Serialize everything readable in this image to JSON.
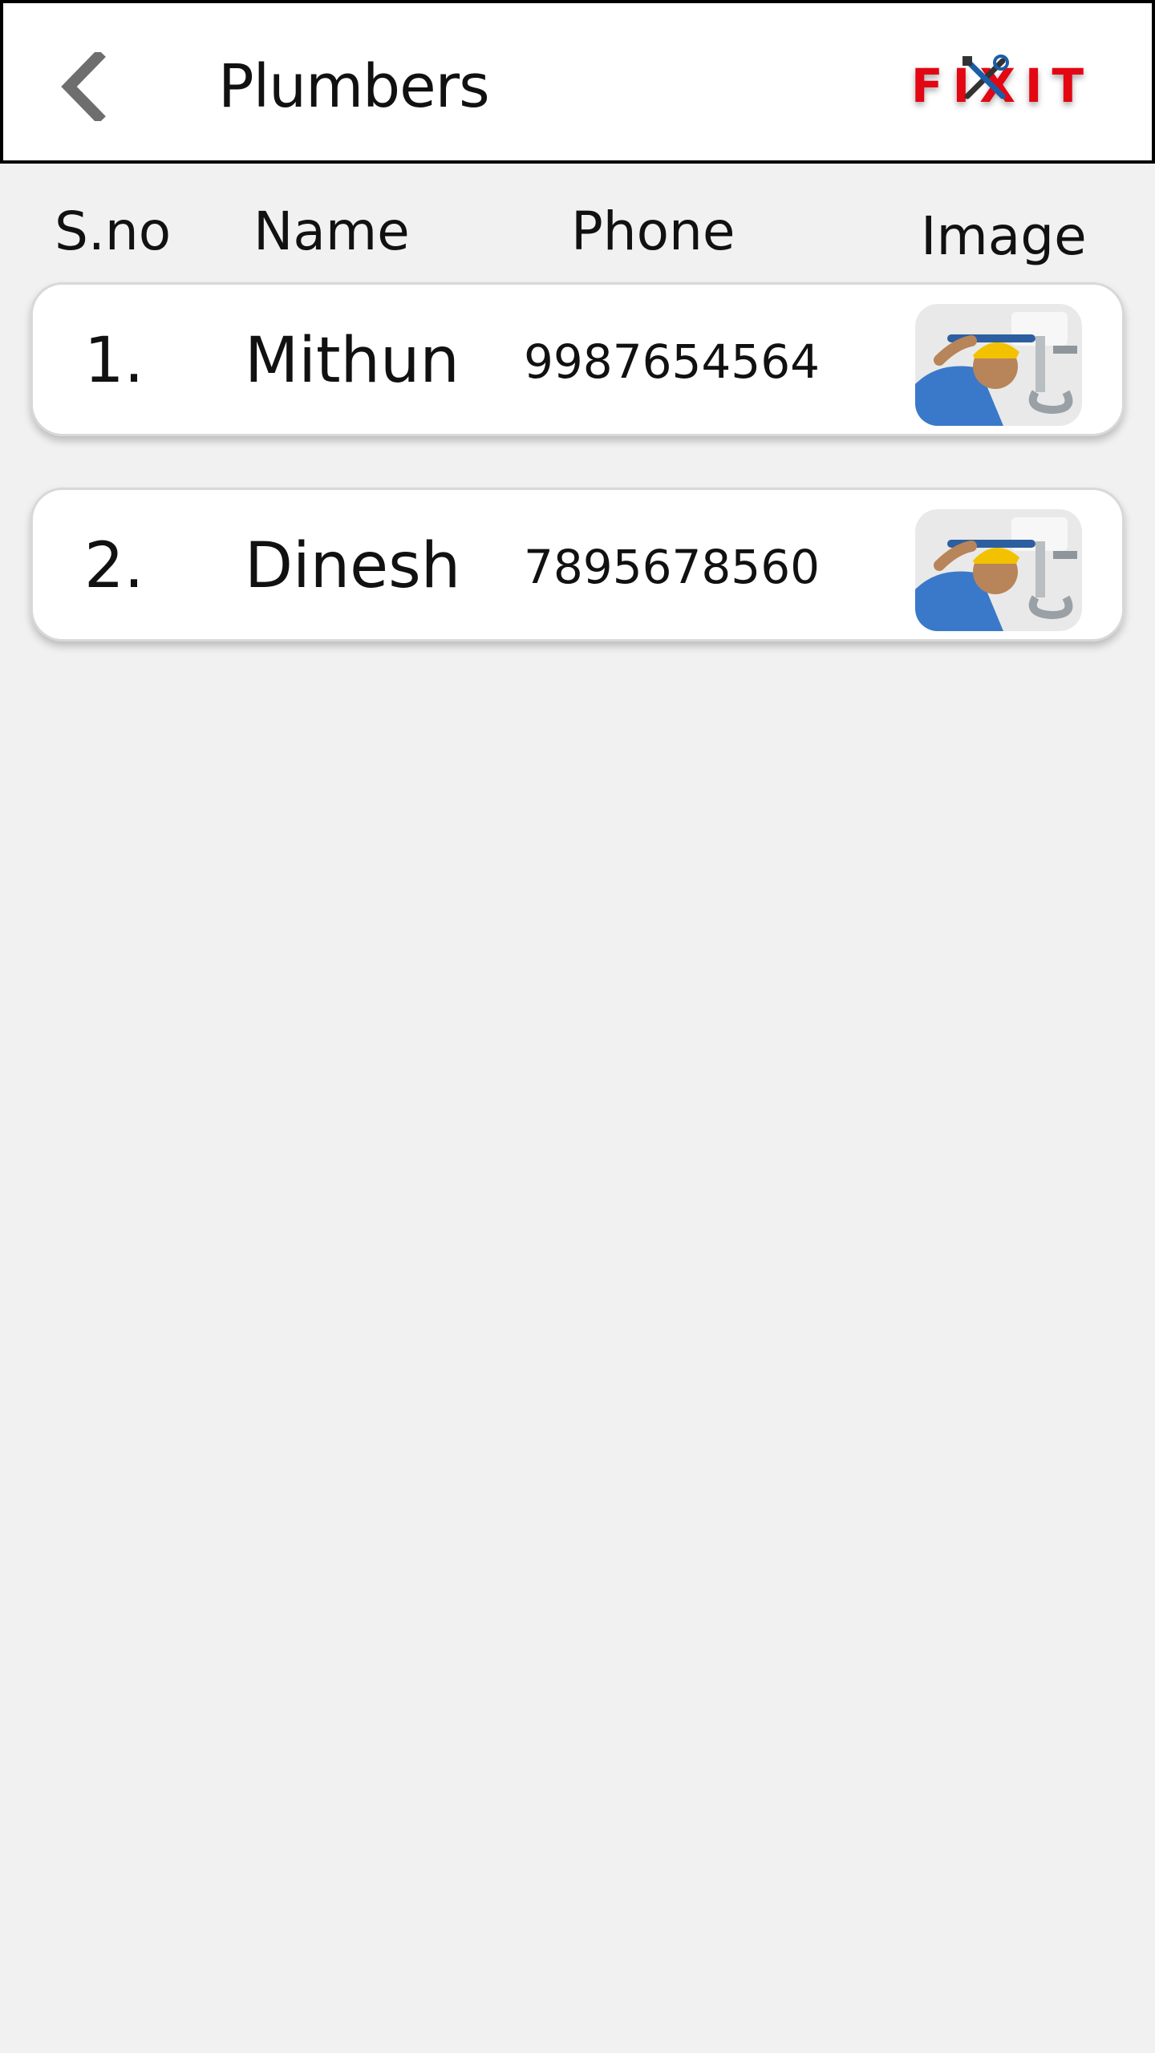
{
  "appbar": {
    "title": "Plumbers",
    "back_icon": "chevron-left-icon",
    "logo_text": "FIXIT",
    "logo_color": "#e30613"
  },
  "table": {
    "headers": {
      "sno": "S.no",
      "name": "Name",
      "phone": "Phone",
      "image": "Image"
    },
    "rows": [
      {
        "sno": "1.",
        "name": "Mithun",
        "phone": "9987654564",
        "image": "plumber-photo"
      },
      {
        "sno": "2.",
        "name": "Dinesh",
        "phone": "7895678560",
        "image": "plumber-photo"
      }
    ]
  },
  "colors": {
    "background": "#f1f1f1",
    "card": "#ffffff",
    "text": "#111111"
  }
}
